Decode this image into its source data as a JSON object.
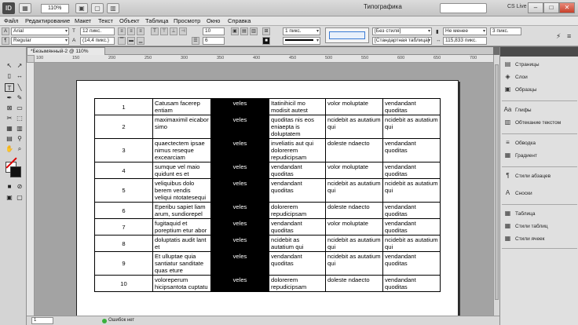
{
  "app": {
    "zoom": "110%",
    "workspace": "Типографика",
    "cs_live": "CS Live",
    "colors": {
      "chrome": "#dcdcdc",
      "canvas": "#a3a3a3",
      "black_col": "#000000",
      "status_ok": "#3bb03b"
    }
  },
  "menu": [
    "Файл",
    "Редактирование",
    "Макет",
    "Текст",
    "Объект",
    "Таблица",
    "Просмотр",
    "Окно",
    "Справка"
  ],
  "control": {
    "font": "Arial",
    "style": "Regular",
    "size": "12 пикс.",
    "leading": "(14,4 пикс.)",
    "rows": "10",
    "cols": "6",
    "stroke": "1 пикс.",
    "cell_style": "[Без стиля]",
    "table_style": "[Стандартная таблица]",
    "width_mode": "Не менее",
    "row_height": "3 пикс.",
    "col_width": "115,833 пикс."
  },
  "doc_tab": "*Безымянный-2 @ 110%",
  "ruler_ticks": [
    "100",
    "150",
    "200",
    "250",
    "300",
    "350",
    "400",
    "450",
    "500",
    "550",
    "600",
    "650",
    "700"
  ],
  "table": {
    "rows": [
      [
        "1",
        "Catusam facerep entiam",
        "veles",
        "Itatinihicil mo modisit autest",
        "volor moluptate",
        "vendandant quoditas"
      ],
      [
        "2",
        "maximaximil eicabor simo",
        "veles",
        "quoditas nis eos eniaepta is doluptatem",
        "ncidebit as autatium qui",
        "ncidebit as autatium qui"
      ],
      [
        "3",
        "quaectectem ipsae nimus reseque excearciam",
        "veles",
        "inveliatis aut qui dolorerem repudicipsam",
        "doleste ndaecto",
        "vendandant quoditas"
      ],
      [
        "4",
        "sumque vel maio quidunt es et",
        "veles",
        "vendandant quoditas",
        "volor moluptate",
        "vendandant quoditas"
      ],
      [
        "5",
        "veliquibus dolo berem vendis veliqui ntotatesequi",
        "veles",
        "vendandant quoditas",
        "ncidebit as autatium qui",
        "ncidebit as autatium qui"
      ],
      [
        "6",
        "Eperibu sapiet liam arum, sundiorepel",
        "veles",
        "dolorerem repudicipsam",
        "doleste ndaecto",
        "vendandant quoditas"
      ],
      [
        "7",
        "fugitaquid et poreptium etur abor",
        "veles",
        "vendandant quoditas",
        "volor moluptate",
        "vendandant quoditas"
      ],
      [
        "8",
        "doluptatis audit lant et",
        "veles",
        "ncidebit as autatium qui",
        "ncidebit as autatium qui",
        "ncidebit as autatium qui"
      ],
      [
        "9",
        "Et ulluptae quia santiatur sanditate quas eture",
        "veles",
        "vendandant quoditas",
        "ncidebit as autatium qui",
        "vendandant quoditas"
      ],
      [
        "10",
        "voloreperum hicipsantota cuptatu",
        "veles",
        "dolorerem repudicipsam",
        "doleste ndaecto",
        "vendandant quoditas"
      ]
    ]
  },
  "panels": [
    {
      "icon": "pages-icon",
      "glyph": "▤",
      "label": "Страницы"
    },
    {
      "icon": "layers-icon",
      "glyph": "◈",
      "label": "Слои"
    },
    {
      "icon": "samples-icon",
      "glyph": "▣",
      "label": "Образцы"
    },
    {
      "icon": "glyphs-icon",
      "glyph": "Aa",
      "label": "Глифы"
    },
    {
      "icon": "text-wrap-icon",
      "glyph": "▥",
      "label": "Обтекание текстом"
    },
    {
      "icon": "stroke-icon",
      "glyph": "≡",
      "label": "Обводка"
    },
    {
      "icon": "gradient-icon",
      "glyph": "▦",
      "label": "Градиент"
    },
    {
      "icon": "paragraph-styles-icon",
      "glyph": "¶",
      "label": "Стили абзацев"
    },
    {
      "icon": "footnotes-icon",
      "glyph": "A",
      "label": "Сноски"
    },
    {
      "icon": "table-icon",
      "glyph": "▦",
      "label": "Таблица"
    },
    {
      "icon": "table-styles-icon",
      "glyph": "▦",
      "label": "Стили таблиц"
    },
    {
      "icon": "cell-styles-icon",
      "glyph": "▦",
      "label": "Стили ячеек"
    }
  ],
  "status": {
    "page": "1",
    "errors": "Ошибок нет"
  }
}
